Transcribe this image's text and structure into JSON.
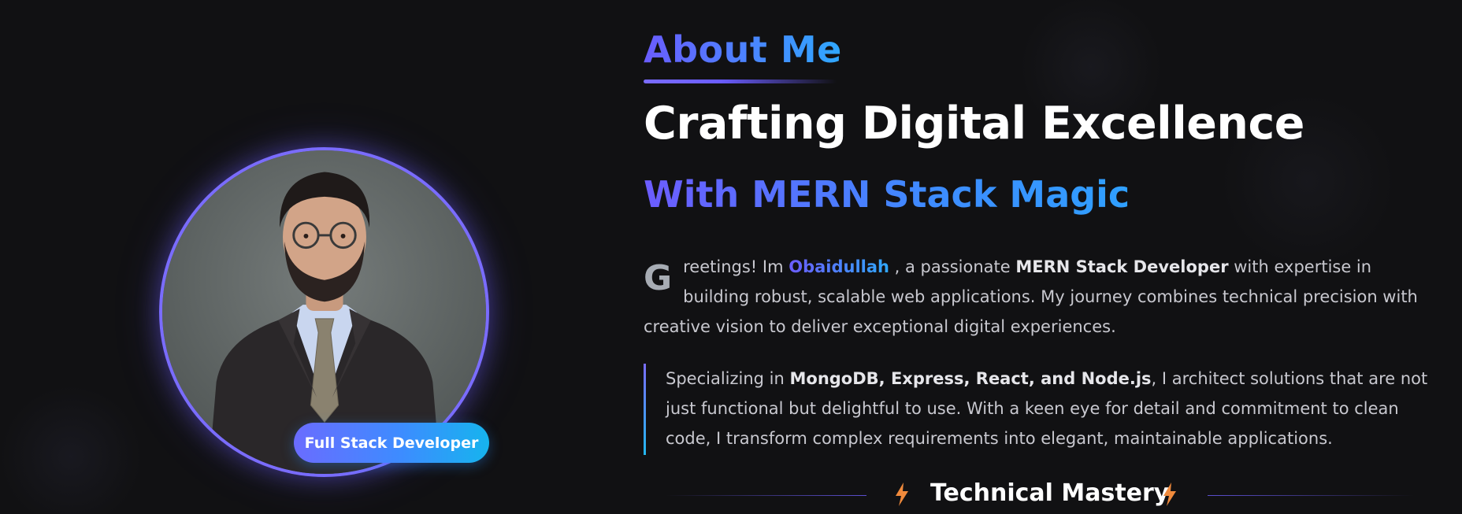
{
  "profile": {
    "badge_label": "Full Stack Developer"
  },
  "about": {
    "title": "About Me",
    "headline": "Crafting Digital Excellence",
    "subheadline": "With MERN Stack Magic"
  },
  "intro": {
    "dropcap": "G",
    "part1": "reetings! Im ",
    "name": "Obaidullah",
    "part2": " , a passionate ",
    "role": "MERN Stack Developer",
    "part3": " with expertise in building robust, scalable web applications. My journey combines technical precision with creative vision to deliver exceptional digital experiences."
  },
  "specialty": {
    "part1": "Specializing in ",
    "stack": "MongoDB, Express, React, and Node.js",
    "part2": ", I architect solutions that are not just functional but delightful to use. With a keen eye for detail and commitment to clean code, I transform complex requirements into elegant, maintainable applications."
  },
  "technical_mastery": {
    "title": "Technical Mastery",
    "icon": "lightning-bolt-icon"
  },
  "colors": {
    "background": "#111113",
    "accent_purple": "#7a6cff",
    "accent_blue": "#2fa8ff",
    "accent_cyan": "#16b4ee",
    "bolt_orange": "#f08a3c"
  }
}
